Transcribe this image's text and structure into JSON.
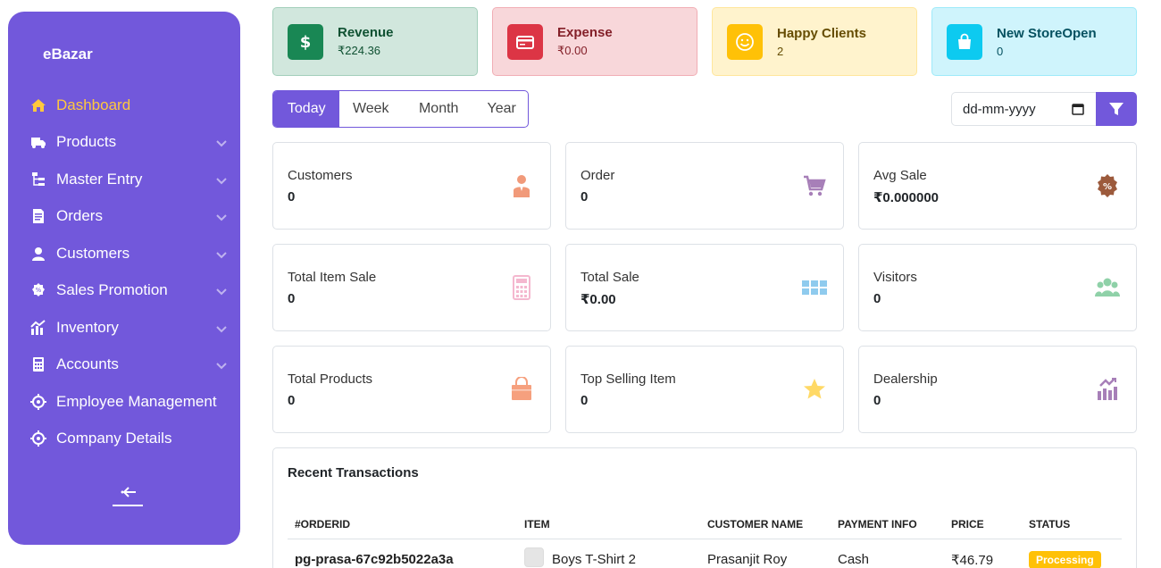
{
  "brand": "eBazar",
  "sidebar": {
    "items": [
      {
        "label": "Dashboard",
        "icon": "home-icon",
        "active": true,
        "chevron": false
      },
      {
        "label": "Products",
        "icon": "truck-icon",
        "chevron": true
      },
      {
        "label": "Master Entry",
        "icon": "sitemap-icon",
        "chevron": true
      },
      {
        "label": "Orders",
        "icon": "document-icon",
        "chevron": true
      },
      {
        "label": "Customers",
        "icon": "user-icon",
        "chevron": true
      },
      {
        "label": "Sales Promotion",
        "icon": "badge-percent-icon",
        "chevron": true
      },
      {
        "label": "Inventory",
        "icon": "chart-icon",
        "chevron": true
      },
      {
        "label": "Accounts",
        "icon": "calculator-icon",
        "chevron": true
      },
      {
        "label": "Employee Management",
        "icon": "target-icon",
        "chevron": false
      },
      {
        "label": "Company Details",
        "icon": "target-icon",
        "chevron": false
      }
    ]
  },
  "top_cards": [
    {
      "label": "Revenue",
      "value": "₹224.36",
      "bg": "#d1e7dd",
      "border": "#a3cfbb",
      "icon_bg": "#198754",
      "text": "#0f5132",
      "icon": "dollar-icon"
    },
    {
      "label": "Expense",
      "value": "₹0.00",
      "bg": "#f8d7da",
      "border": "#f1aeb5",
      "icon_bg": "#dc3545",
      "text": "#842029",
      "icon": "credit-card-icon"
    },
    {
      "label": "Happy Clients",
      "value": "2",
      "bg": "#fff3cd",
      "border": "#ffe69c",
      "icon_bg": "#ffc107",
      "text": "#664d03",
      "icon": "smile-icon"
    },
    {
      "label": "New StoreOpen",
      "value": "0",
      "bg": "#cff4fc",
      "border": "#9eeaf9",
      "icon_bg": "#0dcaf0",
      "text": "#055160",
      "icon": "shopping-bag-icon"
    }
  ],
  "tabs": [
    "Today",
    "Week",
    "Month",
    "Year"
  ],
  "date_placeholder": "dd-mm-yyyy",
  "kpis": [
    {
      "label": "Customers",
      "value": "0",
      "icon": "person-icon",
      "color": "#f19a7a"
    },
    {
      "label": "Order",
      "value": "0",
      "icon": "cart-icon",
      "color": "#a77fb8"
    },
    {
      "label": "Avg Sale",
      "value": "₹0.000000",
      "icon": "discount-badge-icon",
      "color": "#9c5a3c"
    },
    {
      "label": "Total Item Sale",
      "value": "0",
      "icon": "calculator-icon",
      "color": "#f4b8cf"
    },
    {
      "label": "Total Sale",
      "value": "₹0.00",
      "icon": "grid-icon",
      "color": "#8fcbee"
    },
    {
      "label": "Visitors",
      "value": "0",
      "icon": "users-icon",
      "color": "#8fd1a8"
    },
    {
      "label": "Total Products",
      "value": "0",
      "icon": "bag-icon",
      "color": "#f6a07e"
    },
    {
      "label": "Top Selling Item",
      "value": "0",
      "icon": "star-icon",
      "color": "#ffd966"
    },
    {
      "label": "Dealership",
      "value": "0",
      "icon": "handshake-chart-icon",
      "color": "#a77fb8"
    }
  ],
  "transactions": {
    "title": "Recent Transactions",
    "headers": [
      "#ORDERID",
      "ITEM",
      "CUSTOMER NAME",
      "PAYMENT INFO",
      "PRICE",
      "STATUS"
    ],
    "rows": [
      {
        "orderid": "pg-prasa-67c92b5022a3a",
        "item": "Boys T-Shirt 2",
        "customer": "Prasanjit Roy",
        "payment": "Cash",
        "price": "₹46.79",
        "status": "Processing"
      }
    ]
  }
}
